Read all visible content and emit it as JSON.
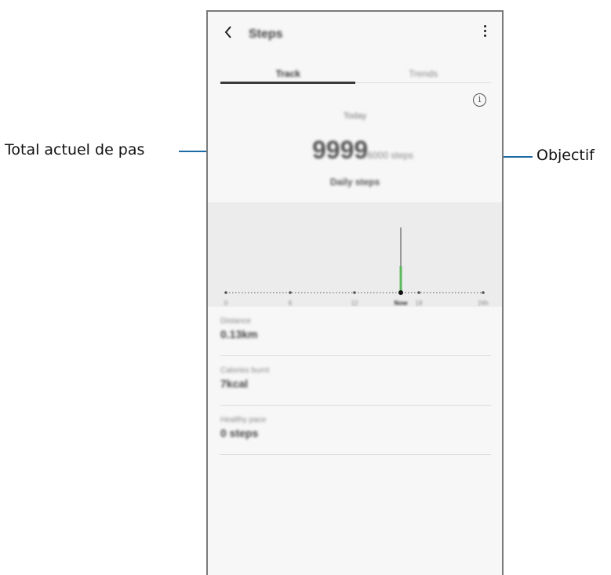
{
  "annotations": {
    "left_label": "Total actuel de pas",
    "right_label": "Objectif",
    "leader_color": "#1c6aa6"
  },
  "app": {
    "title": "Steps",
    "back_icon": "chevron-left-icon",
    "more_icon": "more-vertical-icon"
  },
  "tabs": [
    {
      "label": "Track",
      "active": true
    },
    {
      "label": "Trends",
      "active": false
    }
  ],
  "summary": {
    "date_label": "Today",
    "steps_value": "9999",
    "goal_text": "/6000 steps",
    "caption": "Daily steps"
  },
  "chart_data": {
    "type": "bar",
    "x_tick_labels": [
      "0",
      "6",
      "12",
      "Now",
      "18",
      "24h"
    ],
    "current_marker": "Now",
    "accent_color": "#5cb85c"
  },
  "stats": [
    {
      "label": "Distance",
      "value": "0.13km"
    },
    {
      "label": "Calories burnt",
      "value": "7kcal"
    },
    {
      "label": "Healthy pace",
      "value": "0 steps"
    }
  ]
}
